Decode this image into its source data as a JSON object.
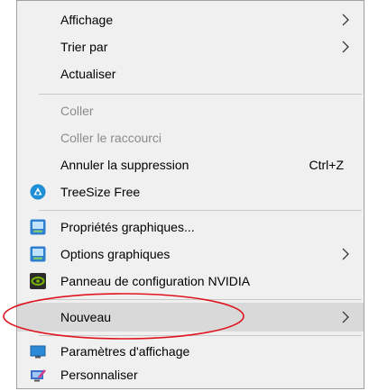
{
  "menu": {
    "items": [
      {
        "label": "Affichage",
        "submenu": true
      },
      {
        "label": "Trier par",
        "submenu": true
      },
      {
        "label": "Actualiser"
      },
      {
        "label": "Coller",
        "disabled": true
      },
      {
        "label": "Coller le raccourci",
        "disabled": true
      },
      {
        "label": "Annuler la suppression",
        "shortcut": "Ctrl+Z"
      },
      {
        "label": "TreeSize Free",
        "icon": "treesize-icon"
      },
      {
        "label": "Propriétés graphiques...",
        "icon": "intel-graphics-icon"
      },
      {
        "label": "Options graphiques",
        "icon": "intel-graphics-icon",
        "submenu": true
      },
      {
        "label": "Panneau de configuration NVIDIA",
        "icon": "nvidia-icon"
      },
      {
        "label": "Nouveau",
        "submenu": true,
        "highlighted": true
      },
      {
        "label": "Paramètres d'affichage",
        "icon": "display-icon"
      },
      {
        "label": "Personnaliser",
        "icon": "personalize-icon"
      }
    ]
  },
  "annotation": {
    "color": "#e0141e",
    "target": "Nouveau"
  }
}
